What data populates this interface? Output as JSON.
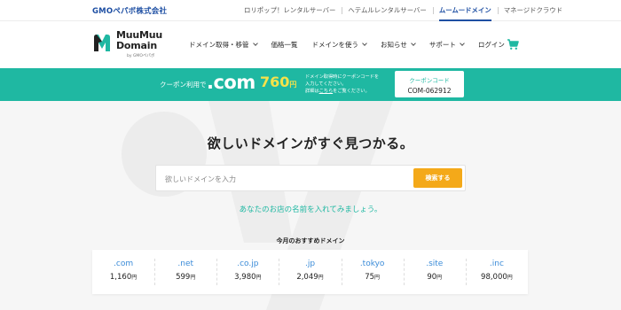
{
  "corporate": {
    "logo_g": "GMO",
    "logo_rest": "ペパボ株式会社",
    "links": [
      {
        "label": "ロリポップ！レンタルサーバー",
        "active": false
      },
      {
        "label": "ヘテムルレンタルサーバー",
        "active": false
      },
      {
        "label": "ムームードメイン",
        "active": true
      },
      {
        "label": "マネージドクラウド",
        "active": false
      }
    ]
  },
  "header": {
    "logo_line1": "MuuMuu",
    "logo_line2": "Domain",
    "logo_sub": "by GMOペパボ",
    "nav": [
      {
        "label": "ドメイン取得・移管",
        "dropdown": true
      },
      {
        "label": "価格一覧",
        "dropdown": false
      },
      {
        "label": "ドメインを使う",
        "dropdown": true
      },
      {
        "label": "お知らせ",
        "dropdown": true
      },
      {
        "label": "サポート",
        "dropdown": true
      },
      {
        "label": "ログイン",
        "dropdown": false
      }
    ],
    "cart_icon": "cart-icon"
  },
  "coupon": {
    "lead": "クーポン利用で",
    "tld": ".com",
    "price": "760",
    "price_unit": "円",
    "note_line1": "ドメイン取得時にクーポンコードを",
    "note_line2": "入力してください。",
    "note_line3_pre": "詳細は",
    "note_line3_link": "こちら",
    "note_line3_post": "をご覧ください。",
    "box_label": "クーポンコード",
    "code": "COM-062912"
  },
  "hero": {
    "title": "欲しいドメインがすぐ見つかる。",
    "search_placeholder": "欲しいドメインを入力",
    "search_button": "検索する",
    "hint": "あなたのお店の名前を入れてみましょう。",
    "recommend_title": "今月のおすすめドメイン"
  },
  "domains": [
    {
      "tld": ".com",
      "price": "1,160",
      "unit": "円"
    },
    {
      "tld": ".net",
      "price": "599",
      "unit": "円"
    },
    {
      "tld": ".co.jp",
      "price": "3,980",
      "unit": "円"
    },
    {
      "tld": ".jp",
      "price": "2,049",
      "unit": "円"
    },
    {
      "tld": ".tokyo",
      "price": "75",
      "unit": "円"
    },
    {
      "tld": ".site",
      "price": "90",
      "unit": "円"
    },
    {
      "tld": ".inc",
      "price": "98,000",
      "unit": "円"
    }
  ],
  "colors": {
    "brand_teal": "#1fb8a2",
    "corporate_blue": "#1e4fa3",
    "search_button": "#f4a919",
    "price_yellow": "#f7e24a",
    "tld_link": "#3a8bd8"
  }
}
